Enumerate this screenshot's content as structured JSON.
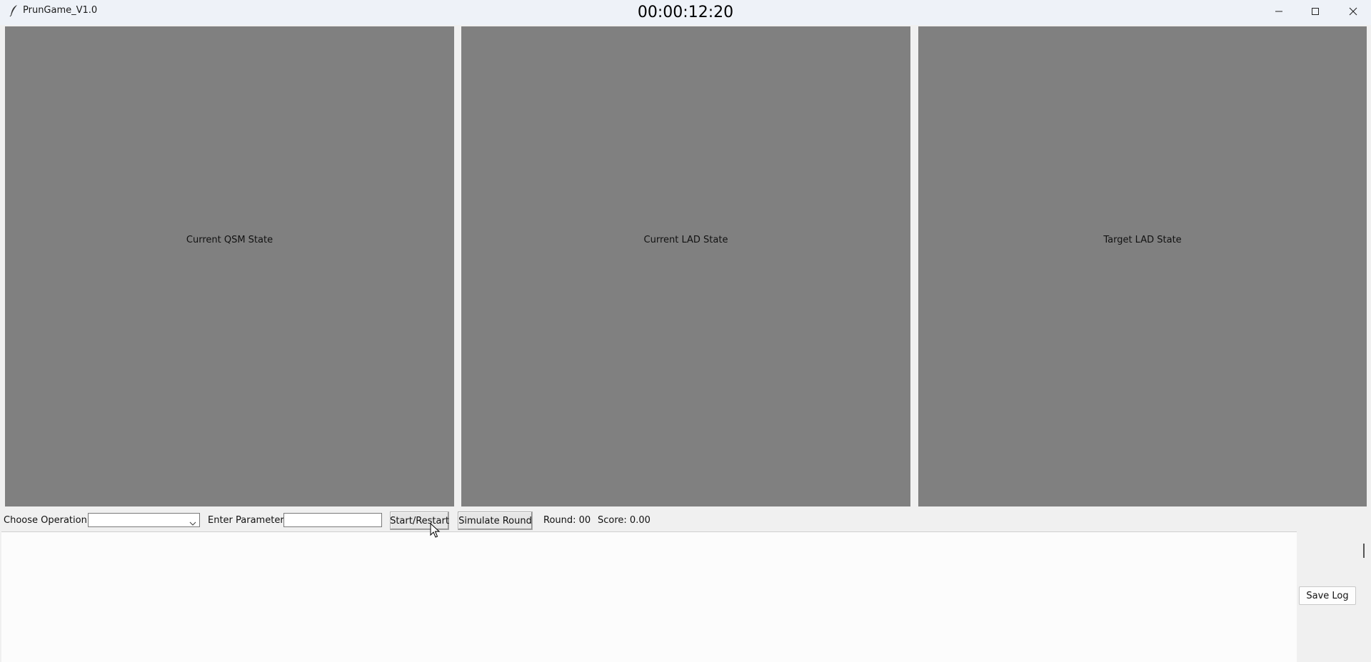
{
  "window": {
    "title": "PrunGame_V1.0",
    "timer": "00:00:12:20"
  },
  "panels": [
    {
      "label": "Current QSM State"
    },
    {
      "label": "Current LAD State"
    },
    {
      "label": "Target LAD State"
    }
  ],
  "controls": {
    "operation_label": "Choose Operation:",
    "operation_value": "",
    "parameter_label": "Enter Parameter:",
    "parameter_value": "",
    "start_button": "Start/Restart",
    "simulate_button": "Simulate Round",
    "round_text": "Round: 00",
    "score_text": "Score: 0.00"
  },
  "log": {
    "content": "",
    "save_button": "Save Log"
  },
  "colors": {
    "panel_background": "#808080",
    "window_background": "#f0f0f0",
    "log_background": "#fcfcfc"
  }
}
